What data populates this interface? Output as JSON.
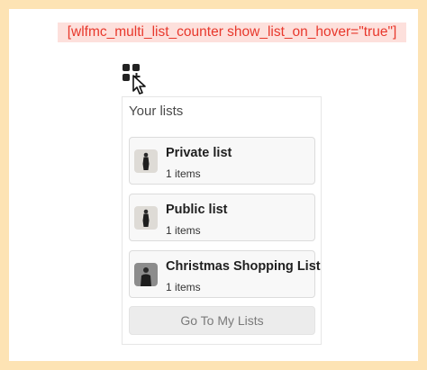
{
  "shortcode_banner": "[wlfmc_multi_list_counter show_list_on_hover=\"true\"]",
  "icons": {
    "counter": "grid-plus-icon",
    "cursor": "pointer-cursor-icon"
  },
  "panel": {
    "title": "Your lists",
    "lists": [
      {
        "name": "Private list",
        "count": "1 items",
        "thumbnail": "product-thumbnail"
      },
      {
        "name": "Public list",
        "count": "1 items",
        "thumbnail": "product-thumbnail"
      },
      {
        "name": "Christmas Shopping List",
        "count": "1 items",
        "thumbnail": "product-thumbnail"
      }
    ],
    "goto_button": "Go To My Lists"
  },
  "colors": {
    "page_border": "#fde3b4",
    "banner_bg": "#fde0dc",
    "banner_text": "#e8382c",
    "button_bg": "#ececec"
  }
}
